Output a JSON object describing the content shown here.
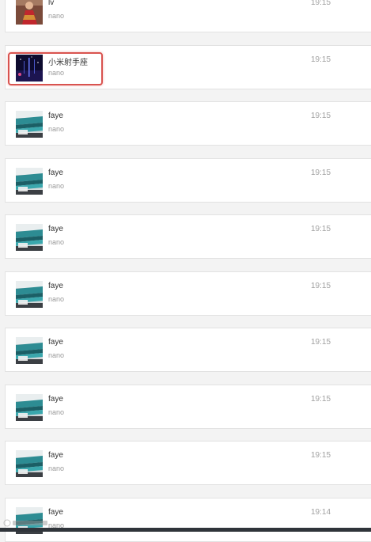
{
  "chats": [
    {
      "name": "lv",
      "preview": "nano",
      "time": "19:15",
      "avatar": "red-dress-photo-avatar"
    },
    {
      "name": "小米射手座",
      "preview": "nano",
      "time": "19:15",
      "avatar": "night-sky-photo-avatar"
    },
    {
      "name": "faye",
      "preview": "nano",
      "time": "19:15",
      "avatar": "teal-room-photo-avatar"
    },
    {
      "name": "faye",
      "preview": "nano",
      "time": "19:15",
      "avatar": "teal-room-photo-avatar"
    },
    {
      "name": "faye",
      "preview": "nano",
      "time": "19:15",
      "avatar": "teal-room-photo-avatar"
    },
    {
      "name": "faye",
      "preview": "nano",
      "time": "19:15",
      "avatar": "teal-room-photo-avatar"
    },
    {
      "name": "faye",
      "preview": "nano",
      "time": "19:15",
      "avatar": "teal-room-photo-avatar"
    },
    {
      "name": "faye",
      "preview": "nano",
      "time": "19:15",
      "avatar": "teal-room-photo-avatar"
    },
    {
      "name": "faye",
      "preview": "nano",
      "time": "19:15",
      "avatar": "teal-room-photo-avatar"
    },
    {
      "name": "faye",
      "preview": "nano",
      "time": "19:14",
      "avatar": "teal-room-photo-avatar"
    }
  ],
  "highlight_color": "#d9534f"
}
